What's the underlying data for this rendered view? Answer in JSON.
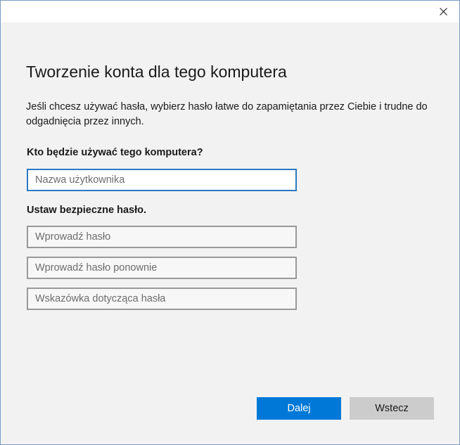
{
  "dialog": {
    "heading": "Tworzenie konta dla tego komputera",
    "description": "Jeśli chcesz używać hasła, wybierz hasło łatwe do zapamiętania przez Ciebie i trudne do odgadnięcia przez innych.",
    "who_label": "Kto będzie używać tego komputera?",
    "username_placeholder": "Nazwa użytkownika",
    "password_label": "Ustaw bezpieczne hasło.",
    "password_placeholder": "Wprowadź hasło",
    "password_repeat_placeholder": "Wprowadź hasło ponownie",
    "hint_placeholder": "Wskazówka dotycząca hasła"
  },
  "buttons": {
    "next_label": "Dalej",
    "back_label": "Wstecz"
  },
  "icons": {
    "close": "close-icon"
  },
  "colors": {
    "accent": "#0078d7",
    "focus_border": "#2b79c2",
    "background": "#f2f2f2"
  }
}
